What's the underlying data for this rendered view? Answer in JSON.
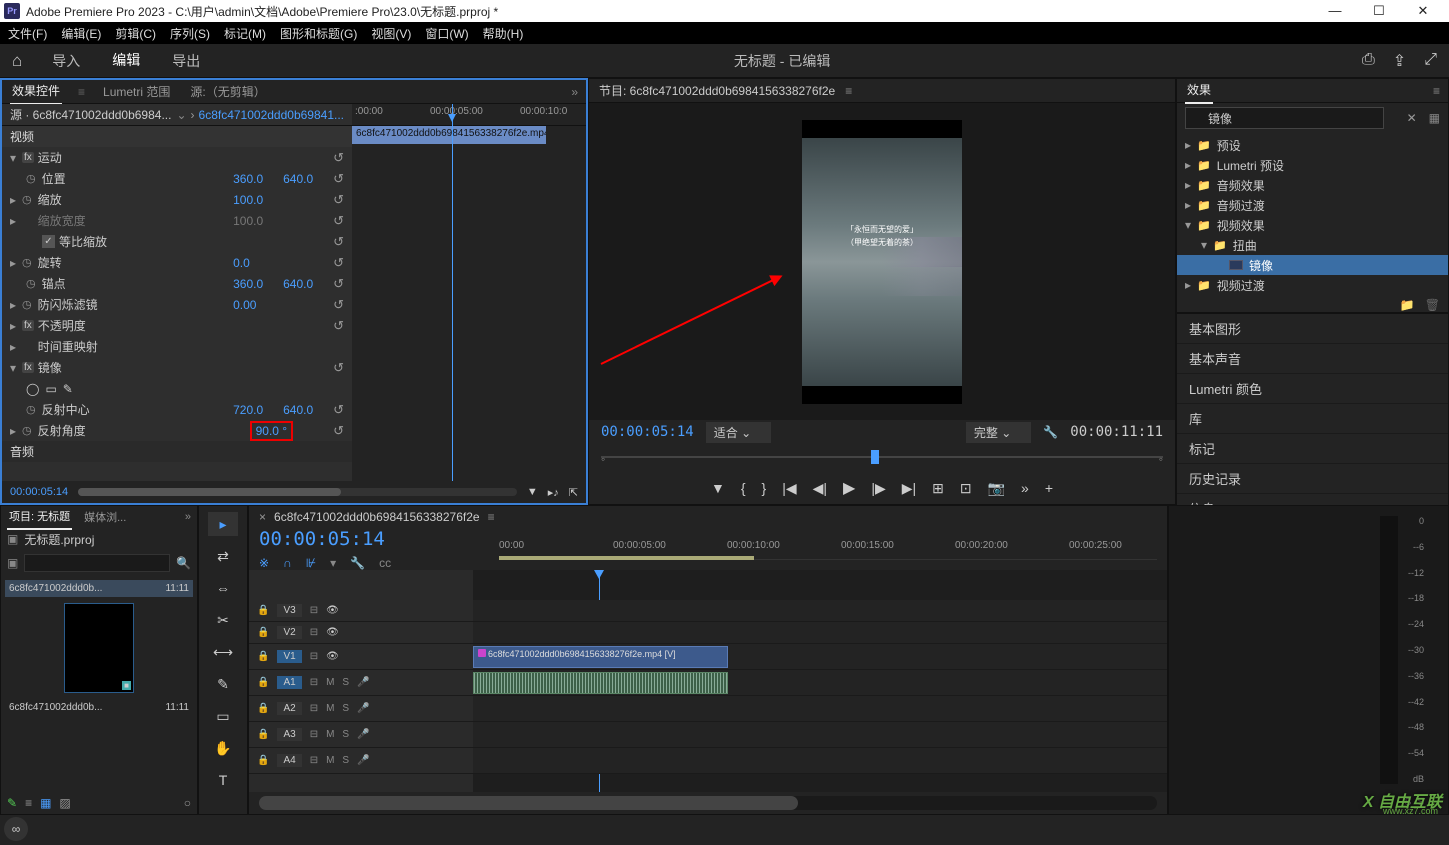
{
  "titlebar": {
    "app_prefix": "Pr",
    "title": "Adobe Premiere Pro 2023 - C:\\用户\\admin\\文档\\Adobe\\Premiere Pro\\23.0\\无标题.prproj *"
  },
  "menubar": {
    "items": [
      "文件(F)",
      "编辑(E)",
      "剪辑(C)",
      "序列(S)",
      "标记(M)",
      "图形和标题(G)",
      "视图(V)",
      "窗口(W)",
      "帮助(H)"
    ]
  },
  "workspace": {
    "tabs": [
      "导入",
      "编辑",
      "导出"
    ],
    "active_index": 1,
    "center_text": "无标题 - 已编辑"
  },
  "effect_controls": {
    "tabs": [
      "效果控件",
      "Lumetri 范围",
      "源:（无剪辑）"
    ],
    "active_tab": 0,
    "source_label": "源 · 6c8fc471002ddd0b6984...",
    "target_label": "6c8fc471002ddd0b69841...",
    "ruler_times": [
      ":00:00",
      "00:00:05:00",
      "00:00:10:0"
    ],
    "clip_bar_label": "6c8fc471002ddd0b6984156338276f2e.mp4",
    "sections": {
      "video": "视频",
      "motion": "运动",
      "position": "位置",
      "position_x": "360.0",
      "position_y": "640.0",
      "scale": "缩放",
      "scale_val": "100.0",
      "scale_width": "缩放宽度",
      "scale_width_val": "100.0",
      "uniform_scale": "等比缩放",
      "rotation": "旋转",
      "rotation_val": "0.0",
      "anchor": "锚点",
      "anchor_x": "360.0",
      "anchor_y": "640.0",
      "antiflicker": "防闪烁滤镜",
      "antiflicker_val": "0.00",
      "opacity": "不透明度",
      "time_remap": "时间重映射",
      "mirror": "镜像",
      "reflect_center": "反射中心",
      "reflect_center_x": "720.0",
      "reflect_center_y": "640.0",
      "reflect_angle": "反射角度",
      "reflect_angle_val": "90.0 °",
      "audio": "音频"
    },
    "footer_timecode": "00:00:05:14"
  },
  "program_monitor": {
    "header": "节目: 6c8fc471002ddd0b6984156338276f2e",
    "video_text1": "「永恒而无望的爱」",
    "video_text2": "（甲绝望无着的茶）",
    "timecode_in": "00:00:05:14",
    "fit_label": "适合",
    "quality_label": "完整",
    "timecode_out": "00:00:11:11"
  },
  "effects_panel": {
    "title": "效果",
    "search_value": "镜像",
    "tree": [
      {
        "indent": 0,
        "disclosure": "▸",
        "icon": "folder",
        "label": "预设"
      },
      {
        "indent": 0,
        "disclosure": "▸",
        "icon": "folder",
        "label": "Lumetri 预设"
      },
      {
        "indent": 0,
        "disclosure": "▸",
        "icon": "folder",
        "label": "音频效果"
      },
      {
        "indent": 0,
        "disclosure": "▸",
        "icon": "folder",
        "label": "音频过渡"
      },
      {
        "indent": 0,
        "disclosure": "▾",
        "icon": "folder",
        "label": "视频效果"
      },
      {
        "indent": 1,
        "disclosure": "▾",
        "icon": "folder",
        "label": "扭曲"
      },
      {
        "indent": 2,
        "disclosure": "",
        "icon": "effect",
        "label": "镜像",
        "selected": true
      },
      {
        "indent": 0,
        "disclosure": "▸",
        "icon": "folder",
        "label": "视频过渡"
      }
    ]
  },
  "side_panels": [
    "基本图形",
    "基本声音",
    "Lumetri 颜色",
    "库",
    "标记",
    "历史记录",
    "信息"
  ],
  "project_panel": {
    "tabs": [
      "项目: 无标题",
      "媒体浏..."
    ],
    "project_name": "无标题.prproj",
    "bins": [
      {
        "name": "6c8fc471002ddd0b...",
        "dur": "11:11",
        "sel": true
      },
      {
        "name": "6c8fc471002ddd0b...",
        "dur": "11:11",
        "sel": false
      }
    ]
  },
  "tools": [
    "▸",
    "⇄",
    "⇔",
    "✂",
    "⟷",
    "✎",
    "▭",
    "✋",
    "T"
  ],
  "timeline": {
    "seq_name": "6c8fc471002ddd0b6984156338276f2e",
    "timecode": "00:00:05:14",
    "ruler_marks": [
      "00:00",
      "00:00:05:00",
      "00:00:10:00",
      "00:00:15:00",
      "00:00:20:00",
      "00:00:25:00"
    ],
    "video_tracks": [
      {
        "label": "V3"
      },
      {
        "label": "V2"
      },
      {
        "label": "V1",
        "active": true
      }
    ],
    "audio_tracks": [
      {
        "label": "A1",
        "active": true
      },
      {
        "label": "A2"
      },
      {
        "label": "A3"
      },
      {
        "label": "A4"
      }
    ],
    "v1_clip": "6c8fc471002ddd0b6984156338276f2e.mp4 [V]",
    "meter_labels": [
      "0",
      "--6",
      "--12",
      "--18",
      "--24",
      "--30",
      "--36",
      "--42",
      "--48",
      "--54",
      "dB"
    ],
    "solo_label": "S"
  },
  "watermark": {
    "main": "X 自由互联",
    "sub": "www.xz7.com"
  }
}
